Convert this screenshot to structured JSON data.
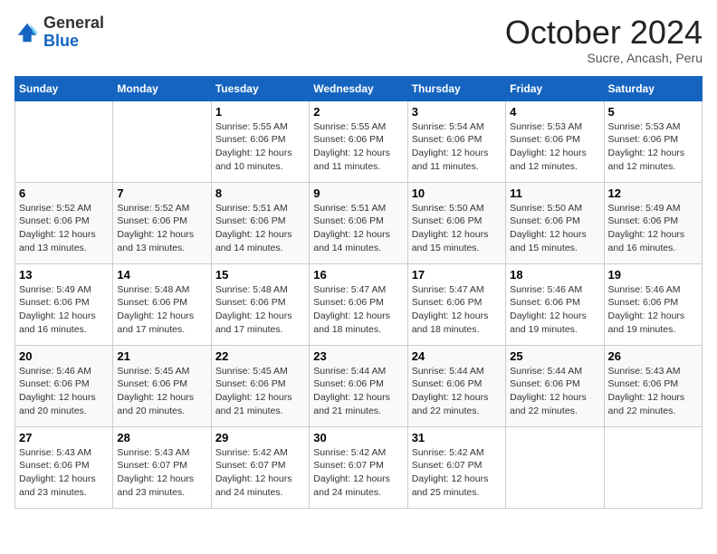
{
  "header": {
    "logo_line1": "General",
    "logo_line2": "Blue",
    "month": "October 2024",
    "location": "Sucre, Ancash, Peru"
  },
  "weekdays": [
    "Sunday",
    "Monday",
    "Tuesday",
    "Wednesday",
    "Thursday",
    "Friday",
    "Saturday"
  ],
  "weeks": [
    [
      {
        "day": "",
        "info": ""
      },
      {
        "day": "",
        "info": ""
      },
      {
        "day": "1",
        "info": "Sunrise: 5:55 AM\nSunset: 6:06 PM\nDaylight: 12 hours and 10 minutes."
      },
      {
        "day": "2",
        "info": "Sunrise: 5:55 AM\nSunset: 6:06 PM\nDaylight: 12 hours and 11 minutes."
      },
      {
        "day": "3",
        "info": "Sunrise: 5:54 AM\nSunset: 6:06 PM\nDaylight: 12 hours and 11 minutes."
      },
      {
        "day": "4",
        "info": "Sunrise: 5:53 AM\nSunset: 6:06 PM\nDaylight: 12 hours and 12 minutes."
      },
      {
        "day": "5",
        "info": "Sunrise: 5:53 AM\nSunset: 6:06 PM\nDaylight: 12 hours and 12 minutes."
      }
    ],
    [
      {
        "day": "6",
        "info": "Sunrise: 5:52 AM\nSunset: 6:06 PM\nDaylight: 12 hours and 13 minutes."
      },
      {
        "day": "7",
        "info": "Sunrise: 5:52 AM\nSunset: 6:06 PM\nDaylight: 12 hours and 13 minutes."
      },
      {
        "day": "8",
        "info": "Sunrise: 5:51 AM\nSunset: 6:06 PM\nDaylight: 12 hours and 14 minutes."
      },
      {
        "day": "9",
        "info": "Sunrise: 5:51 AM\nSunset: 6:06 PM\nDaylight: 12 hours and 14 minutes."
      },
      {
        "day": "10",
        "info": "Sunrise: 5:50 AM\nSunset: 6:06 PM\nDaylight: 12 hours and 15 minutes."
      },
      {
        "day": "11",
        "info": "Sunrise: 5:50 AM\nSunset: 6:06 PM\nDaylight: 12 hours and 15 minutes."
      },
      {
        "day": "12",
        "info": "Sunrise: 5:49 AM\nSunset: 6:06 PM\nDaylight: 12 hours and 16 minutes."
      }
    ],
    [
      {
        "day": "13",
        "info": "Sunrise: 5:49 AM\nSunset: 6:06 PM\nDaylight: 12 hours and 16 minutes."
      },
      {
        "day": "14",
        "info": "Sunrise: 5:48 AM\nSunset: 6:06 PM\nDaylight: 12 hours and 17 minutes."
      },
      {
        "day": "15",
        "info": "Sunrise: 5:48 AM\nSunset: 6:06 PM\nDaylight: 12 hours and 17 minutes."
      },
      {
        "day": "16",
        "info": "Sunrise: 5:47 AM\nSunset: 6:06 PM\nDaylight: 12 hours and 18 minutes."
      },
      {
        "day": "17",
        "info": "Sunrise: 5:47 AM\nSunset: 6:06 PM\nDaylight: 12 hours and 18 minutes."
      },
      {
        "day": "18",
        "info": "Sunrise: 5:46 AM\nSunset: 6:06 PM\nDaylight: 12 hours and 19 minutes."
      },
      {
        "day": "19",
        "info": "Sunrise: 5:46 AM\nSunset: 6:06 PM\nDaylight: 12 hours and 19 minutes."
      }
    ],
    [
      {
        "day": "20",
        "info": "Sunrise: 5:46 AM\nSunset: 6:06 PM\nDaylight: 12 hours and 20 minutes."
      },
      {
        "day": "21",
        "info": "Sunrise: 5:45 AM\nSunset: 6:06 PM\nDaylight: 12 hours and 20 minutes."
      },
      {
        "day": "22",
        "info": "Sunrise: 5:45 AM\nSunset: 6:06 PM\nDaylight: 12 hours and 21 minutes."
      },
      {
        "day": "23",
        "info": "Sunrise: 5:44 AM\nSunset: 6:06 PM\nDaylight: 12 hours and 21 minutes."
      },
      {
        "day": "24",
        "info": "Sunrise: 5:44 AM\nSunset: 6:06 PM\nDaylight: 12 hours and 22 minutes."
      },
      {
        "day": "25",
        "info": "Sunrise: 5:44 AM\nSunset: 6:06 PM\nDaylight: 12 hours and 22 minutes."
      },
      {
        "day": "26",
        "info": "Sunrise: 5:43 AM\nSunset: 6:06 PM\nDaylight: 12 hours and 22 minutes."
      }
    ],
    [
      {
        "day": "27",
        "info": "Sunrise: 5:43 AM\nSunset: 6:06 PM\nDaylight: 12 hours and 23 minutes."
      },
      {
        "day": "28",
        "info": "Sunrise: 5:43 AM\nSunset: 6:07 PM\nDaylight: 12 hours and 23 minutes."
      },
      {
        "day": "29",
        "info": "Sunrise: 5:42 AM\nSunset: 6:07 PM\nDaylight: 12 hours and 24 minutes."
      },
      {
        "day": "30",
        "info": "Sunrise: 5:42 AM\nSunset: 6:07 PM\nDaylight: 12 hours and 24 minutes."
      },
      {
        "day": "31",
        "info": "Sunrise: 5:42 AM\nSunset: 6:07 PM\nDaylight: 12 hours and 25 minutes."
      },
      {
        "day": "",
        "info": ""
      },
      {
        "day": "",
        "info": ""
      }
    ]
  ]
}
